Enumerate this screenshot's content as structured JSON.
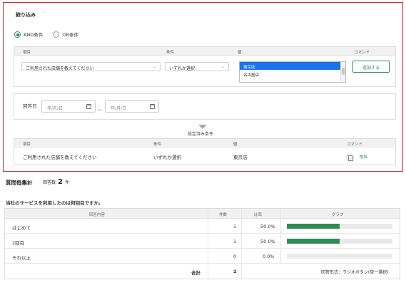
{
  "filter": {
    "title": "絞り込み",
    "toggle_glyph": "＾",
    "radio": {
      "and_label": "AND条件",
      "or_label": "OR条件",
      "selected": "and"
    },
    "headers": {
      "item": "項目",
      "condition": "条件",
      "value": "値",
      "command": "コマンド"
    },
    "item_select": "ご利用された店舗を教えてください",
    "condition_select": "いずれか選択",
    "value_options": [
      {
        "label": "東京店",
        "selected": true
      },
      {
        "label": "名古屋店",
        "selected": false
      }
    ],
    "add_button": "追加する",
    "date_label": "回答日",
    "date_from_placeholder": "年/月/日",
    "date_to_placeholder": "年/月/日",
    "date_separator": "～"
  },
  "set_conditions": {
    "title": "設定済み条件",
    "headers": {
      "item": "項目",
      "condition": "条件",
      "value": "値",
      "command": "コマンド"
    },
    "row": {
      "item": "ご利用された店舗を教えてください",
      "condition": "いずれか選択",
      "value": "東京店",
      "delete_label": "削除"
    }
  },
  "summary": {
    "title": "質問毎集計",
    "answer_count_label": "回答数",
    "answer_count": "2",
    "answer_count_unit": "件"
  },
  "question": "当社のサービスを利用したのは何回目ですか。",
  "results": {
    "headers": {
      "content": "回答内容",
      "count": "件数",
      "ratio": "比率",
      "graph": "グラフ"
    },
    "rows": [
      {
        "content": "はじめて",
        "count": "1",
        "ratio": "50.0%",
        "fill": 0.5
      },
      {
        "content": "2回目",
        "count": "1",
        "ratio": "50.0%",
        "fill": 0.5
      },
      {
        "content": "それ以上",
        "count": "0",
        "ratio": "0.0%",
        "fill": 0
      }
    ],
    "total_label": "合計",
    "total_count": "2",
    "answer_type": "回答形式：ラジオボタン(単一選択)"
  },
  "colors": {
    "accent": "#2e8b57",
    "highlight_border": "#e0262c",
    "selection": "#1a73e8"
  }
}
